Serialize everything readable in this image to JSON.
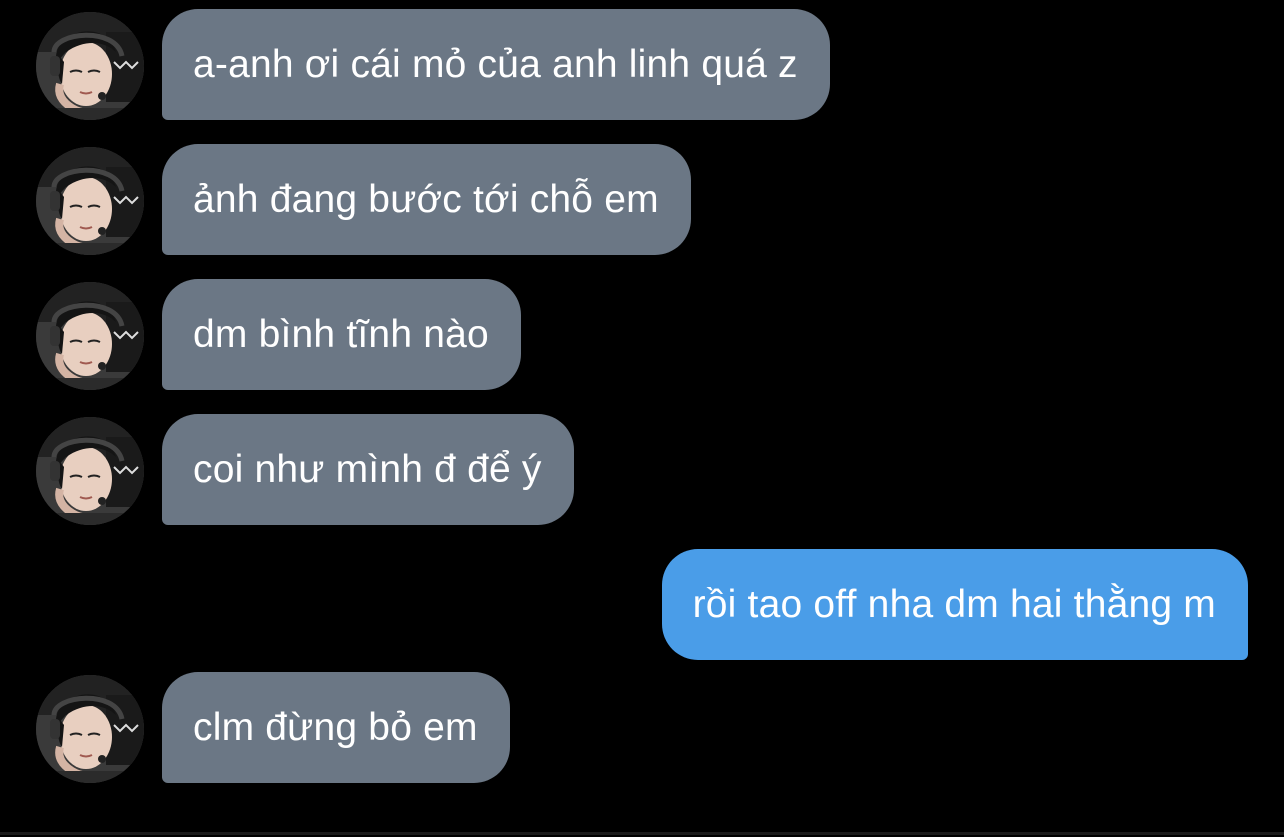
{
  "conversation": {
    "messages": [
      {
        "sender": "incoming",
        "text": "a-anh ơi cái mỏ của anh linh quá z"
      },
      {
        "sender": "incoming",
        "text": "ảnh đang bước tới chỗ em"
      },
      {
        "sender": "incoming",
        "text": "dm bình tĩnh nào"
      },
      {
        "sender": "incoming",
        "text": "coi như mình đ để ý"
      },
      {
        "sender": "outgoing",
        "text": "rồi tao off nha dm hai thằng m"
      },
      {
        "sender": "incoming",
        "text": "clm đừng bỏ em"
      }
    ]
  },
  "colors": {
    "background": "#000000",
    "incoming_bubble": "#6b7785",
    "outgoing_bubble": "#4a9de8",
    "text": "#ffffff"
  },
  "icons": {
    "avatar": "contact-avatar-photo"
  }
}
